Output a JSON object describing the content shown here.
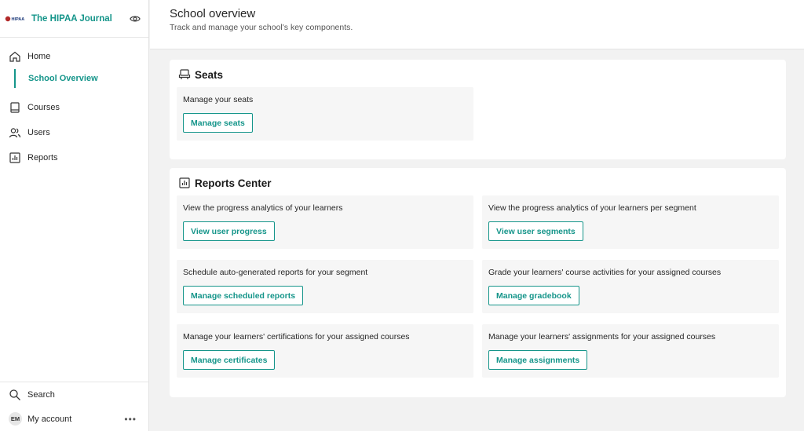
{
  "brand": {
    "name": "The HIPAA Journal",
    "logo_text": "HIPAA"
  },
  "sidebar": {
    "items": [
      {
        "label": "Home",
        "icon": "home-icon"
      },
      {
        "label": "School Overview",
        "active": true
      },
      {
        "label": "Courses",
        "icon": "book-icon"
      },
      {
        "label": "Users",
        "icon": "users-icon"
      },
      {
        "label": "Reports",
        "icon": "chart-icon"
      }
    ],
    "bottom": {
      "search_label": "Search",
      "account_label": "My account",
      "avatar_initials": "EM",
      "more": "•••"
    }
  },
  "header": {
    "title": "School overview",
    "subtitle": "Track and manage your school's key components."
  },
  "seats": {
    "title": "Seats",
    "tiles": [
      {
        "text": "Manage your seats",
        "button": "Manage seats"
      }
    ]
  },
  "reports": {
    "title": "Reports Center",
    "tiles": [
      {
        "text": "View the progress analytics of your learners",
        "button": "View user progress"
      },
      {
        "text": "View the progress analytics of your learners per segment",
        "button": "View user segments"
      },
      {
        "text": "Schedule auto-generated reports for your segment",
        "button": "Manage scheduled reports"
      },
      {
        "text": "Grade your learners' course activities for your assigned courses",
        "button": "Manage gradebook"
      },
      {
        "text": "Manage your learners' certifications for your assigned courses",
        "button": "Manage certificates"
      },
      {
        "text": "Manage your learners' assignments for your assigned courses",
        "button": "Manage assignments"
      }
    ]
  },
  "colors": {
    "accent": "#15958a",
    "background": "#f2f2f2",
    "tile": "#f6f6f6"
  }
}
